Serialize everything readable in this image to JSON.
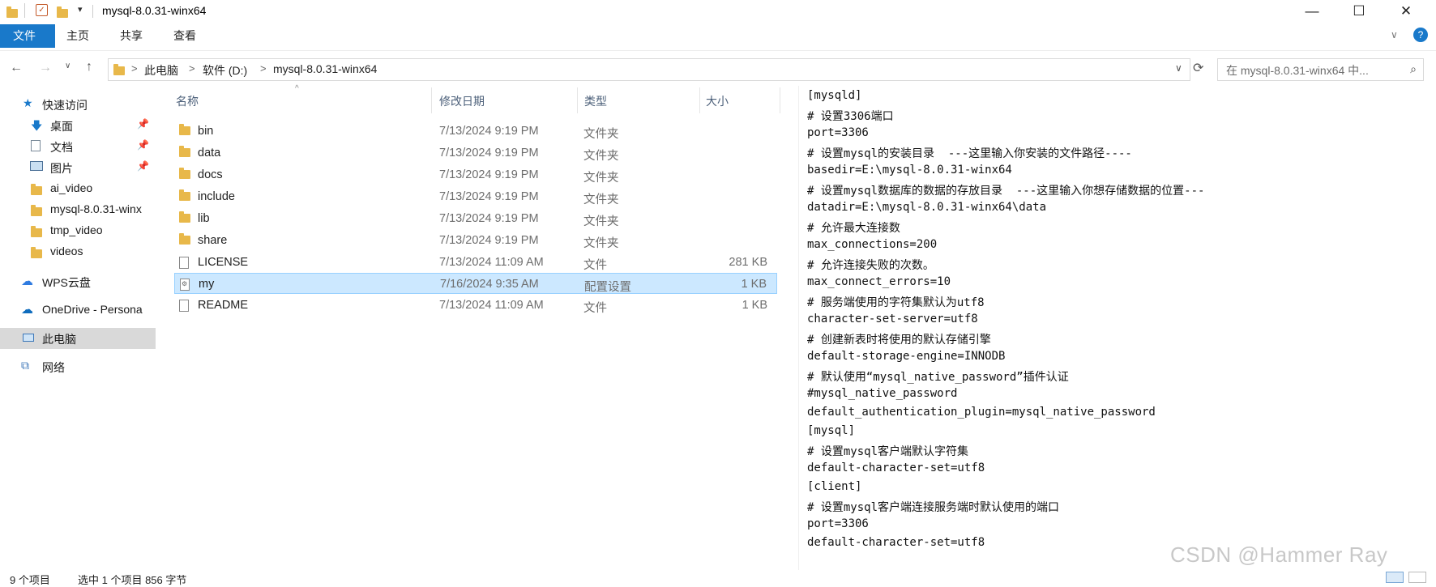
{
  "window": {
    "title": "mysql-8.0.31-winx64"
  },
  "ribbon": {
    "tabs": [
      "文件",
      "主页",
      "共享",
      "查看"
    ]
  },
  "address": {
    "crumbs": [
      "此电脑",
      "软件 (D:)",
      "mysql-8.0.31-winx64"
    ],
    "sep": ">"
  },
  "search": {
    "placeholder": "在 mysql-8.0.31-winx64 中..."
  },
  "nav": {
    "items": [
      {
        "label": "快速访问",
        "icon": "star-icon"
      },
      {
        "label": "桌面",
        "icon": "desktop-icon",
        "pinned": true
      },
      {
        "label": "文档",
        "icon": "document-icon",
        "pinned": true
      },
      {
        "label": "图片",
        "icon": "pictures-icon",
        "pinned": true
      },
      {
        "label": "ai_video",
        "icon": "folder-icon"
      },
      {
        "label": "mysql-8.0.31-winx",
        "icon": "folder-icon"
      },
      {
        "label": "tmp_video",
        "icon": "folder-icon"
      },
      {
        "label": "videos",
        "icon": "folder-icon"
      },
      {
        "label": "WPS云盘",
        "icon": "cloud-icon"
      },
      {
        "label": "OneDrive - Persona",
        "icon": "onedrive-icon"
      },
      {
        "label": "此电脑",
        "icon": "computer-icon"
      },
      {
        "label": "网络",
        "icon": "network-icon"
      }
    ]
  },
  "columns": {
    "name": "名称",
    "date": "修改日期",
    "type": "类型",
    "size": "大小"
  },
  "files": [
    {
      "name": "bin",
      "date": "7/13/2024 9:19 PM",
      "type": "文件夹",
      "size": "",
      "kind": "folder"
    },
    {
      "name": "data",
      "date": "7/13/2024 9:19 PM",
      "type": "文件夹",
      "size": "",
      "kind": "folder"
    },
    {
      "name": "docs",
      "date": "7/13/2024 9:19 PM",
      "type": "文件夹",
      "size": "",
      "kind": "folder"
    },
    {
      "name": "include",
      "date": "7/13/2024 9:19 PM",
      "type": "文件夹",
      "size": "",
      "kind": "folder"
    },
    {
      "name": "lib",
      "date": "7/13/2024 9:19 PM",
      "type": "文件夹",
      "size": "",
      "kind": "folder"
    },
    {
      "name": "share",
      "date": "7/13/2024 9:19 PM",
      "type": "文件夹",
      "size": "",
      "kind": "folder"
    },
    {
      "name": "LICENSE",
      "date": "7/13/2024 11:09 AM",
      "type": "文件",
      "size": "281 KB",
      "kind": "file"
    },
    {
      "name": "my",
      "date": "7/16/2024 9:35 AM",
      "type": "配置设置",
      "size": "1 KB",
      "kind": "config"
    },
    {
      "name": "README",
      "date": "7/13/2024 11:09 AM",
      "type": "文件",
      "size": "1 KB",
      "kind": "file"
    }
  ],
  "preview": {
    "lines": [
      "[mysqld]",
      "# 设置3306端口",
      "port=3306",
      "# 设置mysql的安装目录  ---这里输入你安装的文件路径----",
      "basedir=E:\\mysql-8.0.31-winx64",
      "# 设置mysql数据库的数据的存放目录  ---这里输入你想存储数据的位置---",
      "datadir=E:\\mysql-8.0.31-winx64\\data",
      "# 允许最大连接数",
      "max_connections=200",
      "# 允许连接失败的次数。",
      "max_connect_errors=10",
      "# 服务端使用的字符集默认为utf8",
      "character-set-server=utf8",
      "# 创建新表时将使用的默认存储引擎",
      "default-storage-engine=INNODB",
      "# 默认使用“mysql_native_password”插件认证",
      "#mysql_native_password",
      "default_authentication_plugin=mysql_native_password",
      "[mysql]",
      "# 设置mysql客户端默认字符集",
      "default-character-set=utf8",
      "[client]",
      "# 设置mysql客户端连接服务端时默认使用的端口",
      "port=3306",
      "default-character-set=utf8"
    ]
  },
  "status": {
    "count": "9 个项目",
    "selection": "选中 1 个项目  856 字节"
  },
  "watermark": "CSDN @Hammer Ray",
  "colors": {
    "accent": "#1979ca",
    "selection": "#cce8ff",
    "folder": "#e8b84a"
  }
}
